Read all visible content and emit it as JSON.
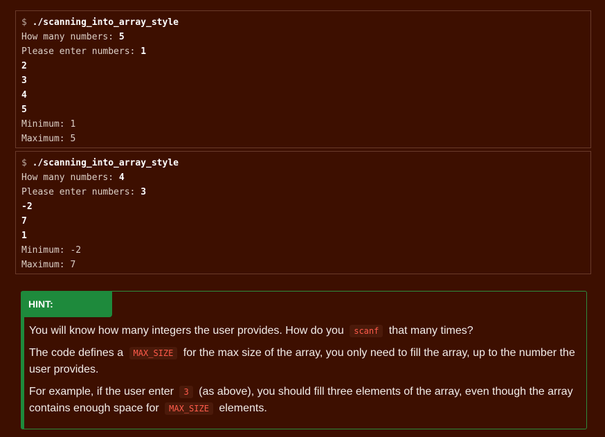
{
  "terminal1": {
    "prompt": "$",
    "command": "./scanning_into_array_style",
    "count_label": "How many numbers:",
    "count_value": "5",
    "enter_label": "Please enter numbers:",
    "inputs": [
      "1",
      "2",
      "3",
      "4",
      "5"
    ],
    "min_label": "Minimum:",
    "min_value": "1",
    "max_label": "Maximum:",
    "max_value": "5"
  },
  "terminal2": {
    "prompt": "$",
    "command": "./scanning_into_array_style",
    "count_label": "How many numbers:",
    "count_value": "4",
    "enter_label": "Please enter numbers:",
    "inputs": [
      "3",
      "-2",
      "7",
      "1"
    ],
    "min_label": "Minimum:",
    "min_value": "-2",
    "max_label": "Maximum:",
    "max_value": "7"
  },
  "hint": {
    "title": "HINT:",
    "p1_before": "You will know how many integers the user provides. How do you",
    "p1_code": "scanf",
    "p1_after": "that many times?",
    "p2_before": "The code defines a",
    "p2_code": "MAX_SIZE",
    "p2_after": "for the max size of the array, you only need to fill the array, up to the number the user provides.",
    "p3_before": "For example, if the user enter",
    "p3_code": "3",
    "p3_middle": "(as above), you should fill three elements of the array, even though the array contains enough space for",
    "p3_code2": "MAX_SIZE",
    "p3_after": "elements."
  },
  "colors": {
    "background": "#3d0f00",
    "hint_accent": "#1e8a3c",
    "code_text": "#ff5a4a"
  }
}
